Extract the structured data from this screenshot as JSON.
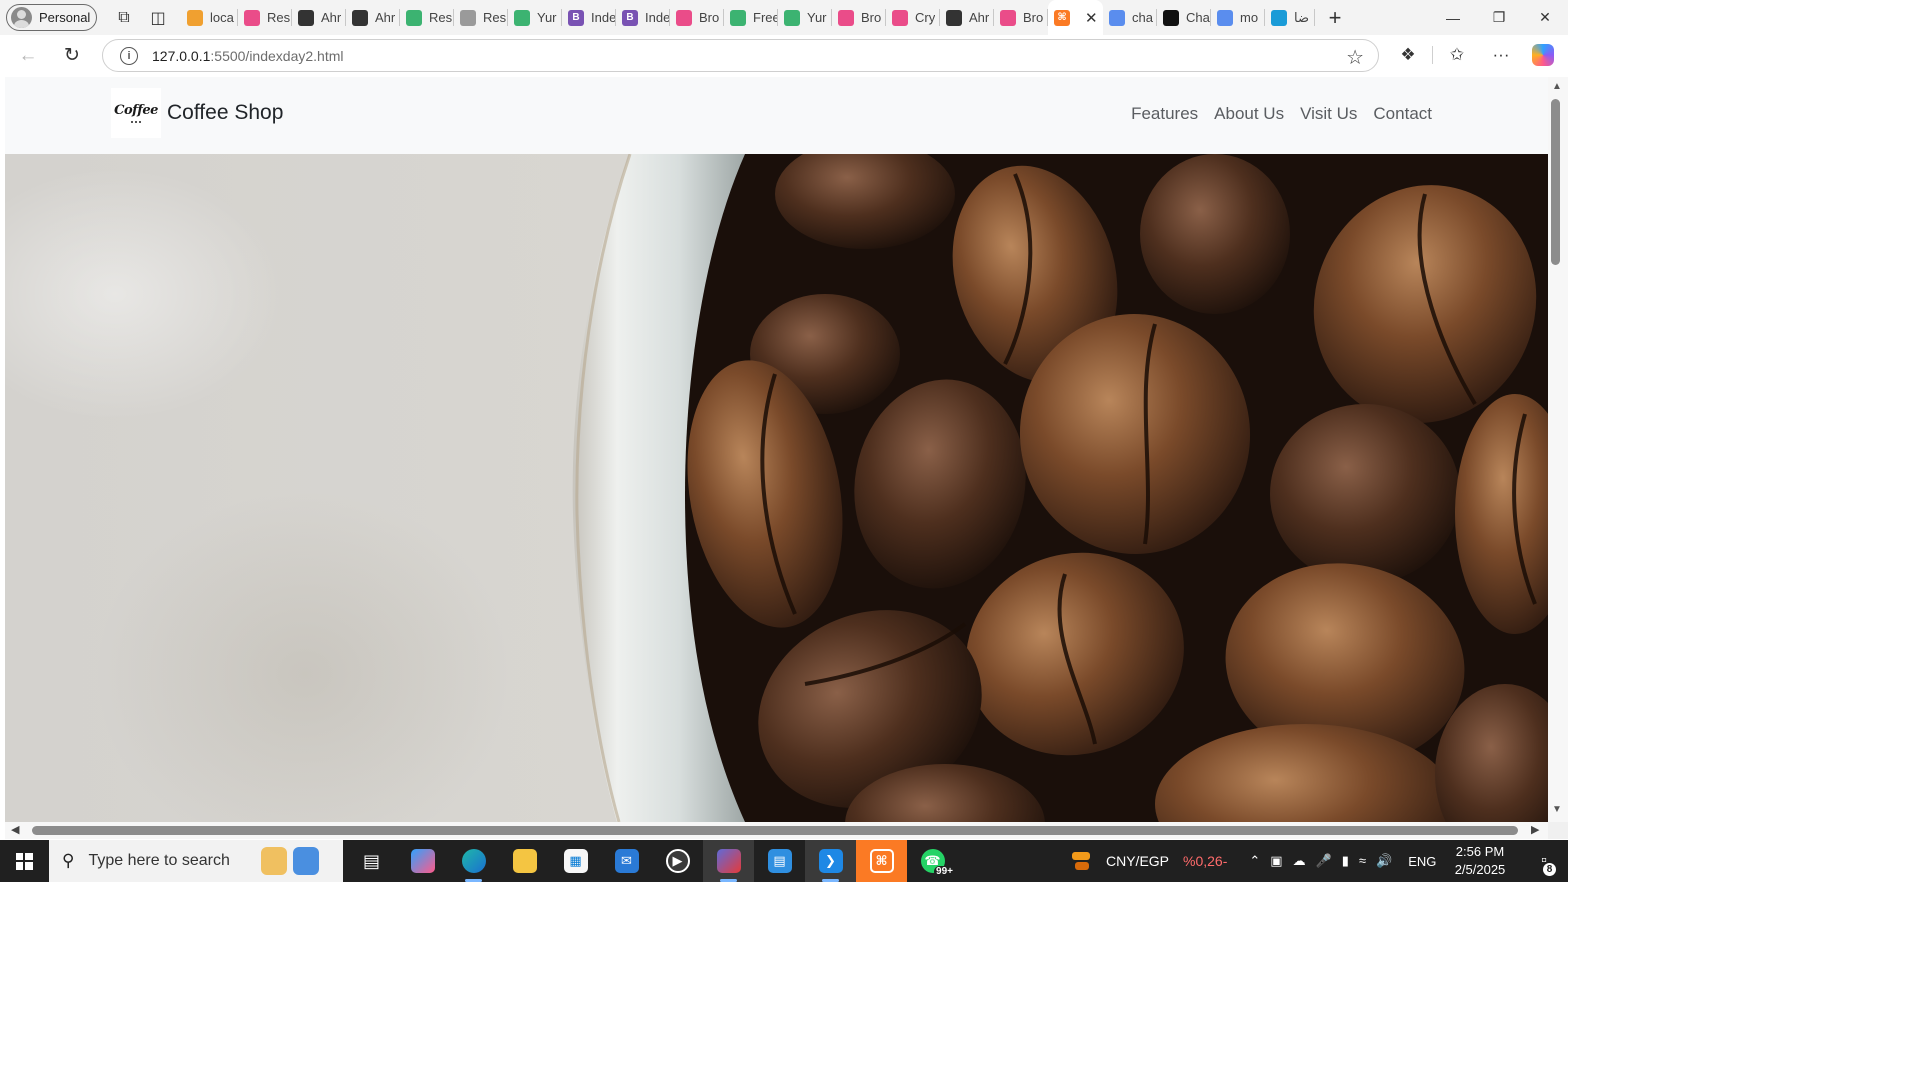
{
  "browser": {
    "profile_label": "Personal",
    "tabs": [
      {
        "title": "loca",
        "icon": "pma-icon",
        "color": "#f0a030"
      },
      {
        "title": "Res",
        "icon": "dribbble-icon",
        "color": "#ea4c89"
      },
      {
        "title": "Ahr",
        "icon": "github-icon",
        "color": "#333333"
      },
      {
        "title": "Ahr",
        "icon": "github-icon",
        "color": "#333333"
      },
      {
        "title": "Res",
        "icon": "leaf-icon",
        "color": "#3cb371"
      },
      {
        "title": "Res",
        "icon": "page-icon",
        "color": "#9a9a9a"
      },
      {
        "title": "Yur",
        "icon": "leaf-icon",
        "color": "#3cb371"
      },
      {
        "title": "Inde",
        "icon": "bootstrap-icon",
        "color": "#7952b3"
      },
      {
        "title": "Inde",
        "icon": "bootstrap-icon",
        "color": "#7952b3"
      },
      {
        "title": "Bro",
        "icon": "dribbble-icon",
        "color": "#ea4c89"
      },
      {
        "title": "Free",
        "icon": "leaf-icon",
        "color": "#3cb371"
      },
      {
        "title": "Yur",
        "icon": "leaf-icon",
        "color": "#3cb371"
      },
      {
        "title": "Bro",
        "icon": "dribbble-icon",
        "color": "#ea4c89"
      },
      {
        "title": "Cry",
        "icon": "dribbble-icon",
        "color": "#ea4c89"
      },
      {
        "title": "Ahr",
        "icon": "github-icon",
        "color": "#333333"
      },
      {
        "title": "Bro",
        "icon": "dribbble-icon",
        "color": "#ea4c89"
      },
      {
        "title": "",
        "icon": "xampp-icon",
        "color": "#fb7a24",
        "active": true
      },
      {
        "title": "cha",
        "icon": "search-icon",
        "color": "#5a8dee"
      },
      {
        "title": "Cha",
        "icon": "openai-icon",
        "color": "#111111"
      },
      {
        "title": "mo",
        "icon": "search-icon",
        "color": "#5a8dee"
      },
      {
        "title": "ضا",
        "icon": "circle-icon",
        "color": "#1a9bd7"
      }
    ],
    "url_host": "127.0.0.1",
    "url_rest": ":5500/indexday2.html"
  },
  "site": {
    "brand_logo_text": "Coffee",
    "brand_name": "Coffee Shop",
    "nav": [
      "Features",
      "About Us",
      "Visit Us",
      "Contact"
    ]
  },
  "taskbar": {
    "search_placeholder": "Type here to search",
    "whatsapp_badge": "99+",
    "currency_pair": "CNY/EGP",
    "currency_change": "%0,26-",
    "language": "ENG",
    "time": "2:56 PM",
    "date": "2/5/2025",
    "notification_count": "8"
  }
}
